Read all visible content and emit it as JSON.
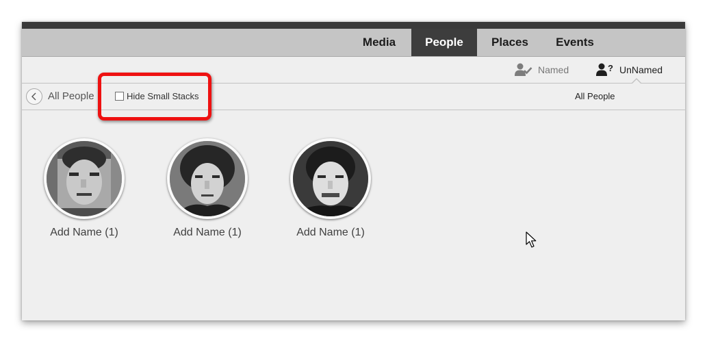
{
  "tabs": [
    {
      "label": "Media",
      "active": false
    },
    {
      "label": "People",
      "active": true
    },
    {
      "label": "Places",
      "active": false
    },
    {
      "label": "Events",
      "active": false
    }
  ],
  "subtabs": {
    "named": {
      "label": "Named",
      "icon": "person-check-icon"
    },
    "unnamed": {
      "label": "UnNamed",
      "icon": "person-question-icon",
      "active": true
    }
  },
  "filterbar": {
    "back_label": "All People",
    "hide_small_stacks": {
      "label": "Hide Small Stacks",
      "checked": false
    },
    "scope_label": "All People"
  },
  "people": [
    {
      "label": "Add Name (1)"
    },
    {
      "label": "Add Name (1)"
    },
    {
      "label": "Add Name (1)"
    }
  ],
  "colors": {
    "highlight": "#ee1111",
    "active_tab_bg": "#3d3d3d",
    "tabbar_bg": "#c5c5c5"
  }
}
